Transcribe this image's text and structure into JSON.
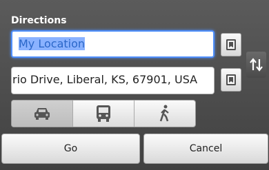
{
  "dialog": {
    "title": "Directions"
  },
  "start": {
    "value": "My Location",
    "book_icon": "contacts-book-icon"
  },
  "destination": {
    "value": "rio Drive, Liberal, KS, 67901, USA",
    "book_icon": "contacts-book-icon"
  },
  "swap": {
    "icon": "swap-arrows-icon"
  },
  "travel_modes": {
    "items": [
      {
        "mode": "driving",
        "icon": "car-icon",
        "selected": true
      },
      {
        "mode": "transit",
        "icon": "bus-icon",
        "selected": false
      },
      {
        "mode": "walking",
        "icon": "walking-person-icon",
        "selected": false
      }
    ]
  },
  "buttons": {
    "go_label": "Go",
    "cancel_label": "Cancel"
  },
  "colors": {
    "accent": "#4f90ff",
    "selection": "#8ab2ff"
  }
}
